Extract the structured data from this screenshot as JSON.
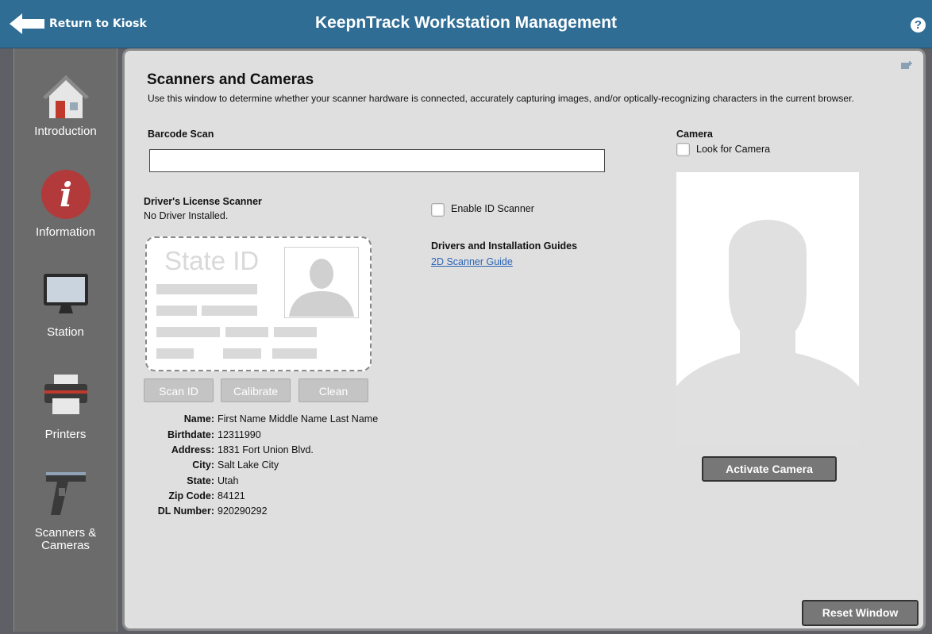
{
  "header": {
    "back_label": "Return to Kiosk",
    "title": "KeepnTrack Workstation Management",
    "help_symbol": "?"
  },
  "sidebar": {
    "items": [
      {
        "label": "Introduction",
        "icon": "house-icon"
      },
      {
        "label": "Information",
        "icon": "info-icon"
      },
      {
        "label": "Station",
        "icon": "monitor-icon"
      },
      {
        "label": "Printers",
        "icon": "printer-icon"
      },
      {
        "label": "Scanners & Cameras",
        "icon": "barcode-scanner-icon"
      }
    ]
  },
  "main": {
    "title": "Scanners and Cameras",
    "description": "Use this window to determine whether your scanner hardware is connected, accurately capturing images, and/or optically-recognizing characters in the current browser.",
    "barcode": {
      "label": "Barcode Scan",
      "value": ""
    },
    "dl_scanner": {
      "label": "Driver's License Scanner",
      "status": "No Driver Installed.",
      "card_text": "State ID",
      "enable_label": "Enable ID Scanner",
      "buttons": {
        "scan": "Scan ID",
        "calibrate": "Calibrate",
        "clean": "Clean"
      }
    },
    "drivers": {
      "label": "Drivers and Installation Guides",
      "link": "2D Scanner Guide"
    },
    "fields": [
      {
        "key": "Name:",
        "value": "First Name Middle Name Last Name"
      },
      {
        "key": "Birthdate:",
        "value": "12311990"
      },
      {
        "key": "Address:",
        "value": "1831 Fort Union Blvd."
      },
      {
        "key": "City:",
        "value": "Salt Lake City"
      },
      {
        "key": "State:",
        "value": "Utah"
      },
      {
        "key": "Zip Code:",
        "value": "84121"
      },
      {
        "key": "DL Number:",
        "value": "920290292"
      }
    ],
    "camera": {
      "label": "Camera",
      "look_label": "Look for Camera",
      "activate_label": "Activate Camera"
    },
    "reset_label": "Reset Window"
  },
  "colors": {
    "header_bg": "#2f6d95",
    "sidebar_bg": "#6b6b6b",
    "panel_bg": "#dfdfe0",
    "info_red": "#b33a3a",
    "link": "#2b64b5"
  }
}
